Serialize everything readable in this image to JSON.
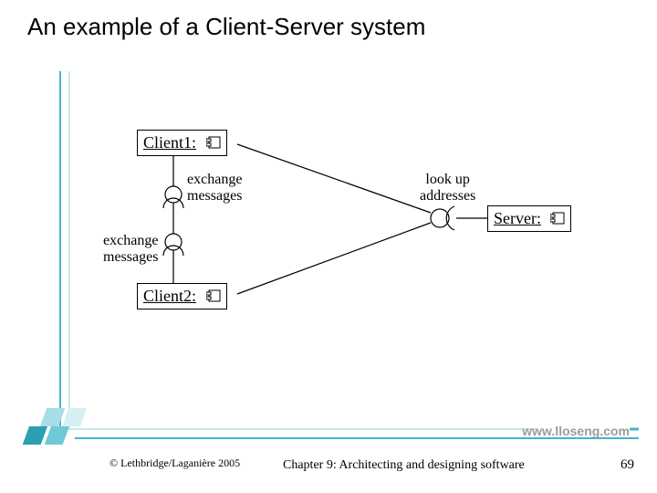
{
  "title": "An example of a Client-Server system",
  "nodes": {
    "client1": "Client1:",
    "client2": "Client2:",
    "server": "Server:"
  },
  "labels": {
    "exchange1a": "exchange",
    "exchange1b": "messages",
    "exchange2a": "exchange",
    "exchange2b": "messages",
    "lookup_a": "look up",
    "lookup_b": "addresses"
  },
  "footer": {
    "url": "www.lloseng.com",
    "copyright": "© Lethbridge/Laganière 2005",
    "chapter": "Chapter 9: Architecting and designing software",
    "page": "69"
  },
  "colors": {
    "accent": "#3fb8c9"
  }
}
